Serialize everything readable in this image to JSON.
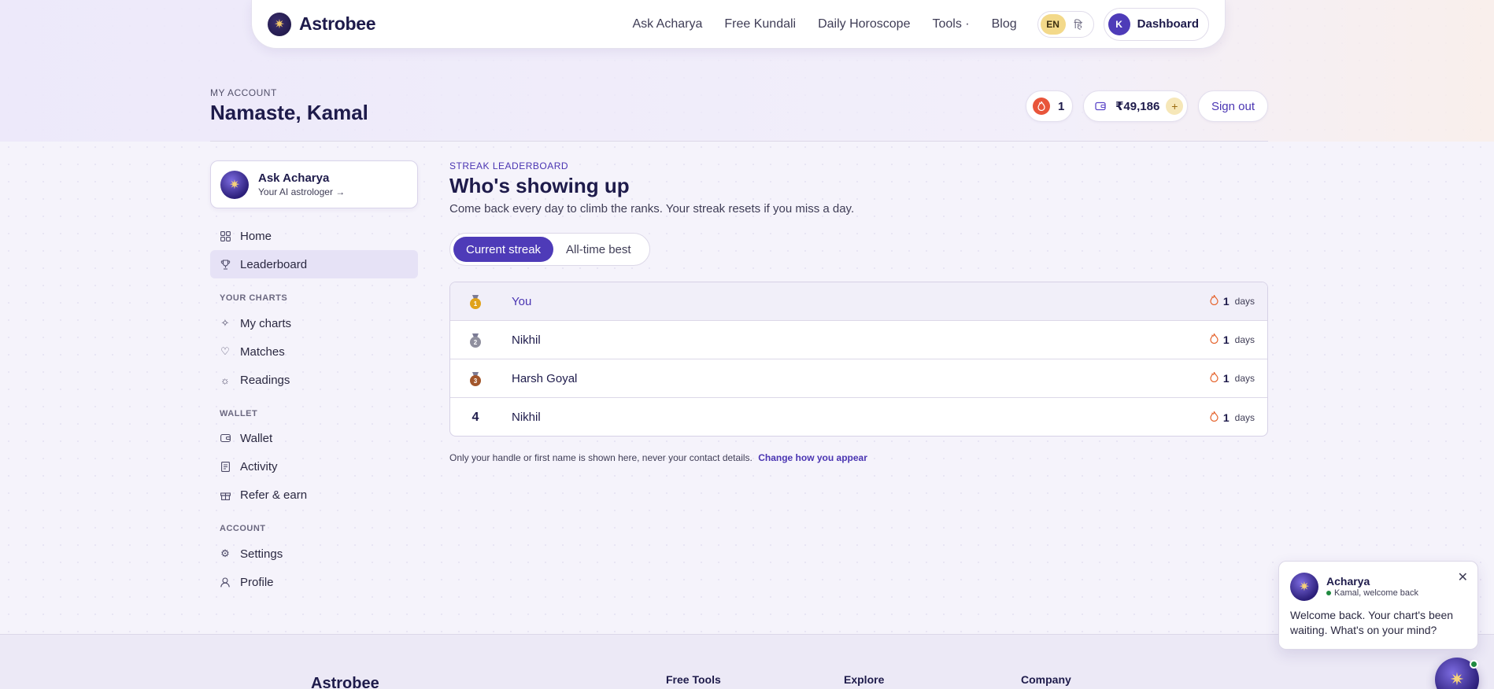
{
  "nav": {
    "brand": "Astrobee",
    "links": [
      "Ask Acharya",
      "Free Kundali",
      "Daily Horoscope",
      "Tools ·",
      "Blog"
    ],
    "lang_en": "EN",
    "lang_hi": "हि",
    "avatar_initial": "K",
    "dashboard_label": "Dashboard"
  },
  "header": {
    "eyebrow": "MY ACCOUNT",
    "title": "Namaste, Kamal",
    "streak_count": "1",
    "wallet_amount": "₹49,186",
    "wallet_add": "+",
    "signout_label": "Sign out"
  },
  "sidebar": {
    "ask_title": "Ask Acharya",
    "ask_sub": "Your AI astrologer →",
    "items": [
      {
        "label": "Home",
        "icon": "grid-icon"
      },
      {
        "label": "Leaderboard",
        "icon": "trophy-icon"
      }
    ],
    "sections": [
      {
        "title": "YOUR CHARTS",
        "items": [
          {
            "label": "My charts",
            "icon": "sparkle-icon"
          },
          {
            "label": "Matches",
            "icon": "heart-icon"
          },
          {
            "label": "Readings",
            "icon": "sun-icon"
          }
        ]
      },
      {
        "title": "WALLET",
        "items": [
          {
            "label": "Wallet",
            "icon": "wallet-icon"
          },
          {
            "label": "Activity",
            "icon": "receipt-icon"
          },
          {
            "label": "Refer & earn",
            "icon": "gift-icon"
          }
        ]
      },
      {
        "title": "ACCOUNT",
        "items": [
          {
            "label": "Settings",
            "icon": "gear-icon"
          },
          {
            "label": "Profile",
            "icon": "user-icon"
          }
        ]
      }
    ]
  },
  "main": {
    "eyebrow": "STREAK LEADERBOARD",
    "title": "Who's showing up",
    "subtitle": "Come back every day to climb the ranks. Your streak resets if you miss a day.",
    "tabs": [
      "Current streak",
      "All-time best"
    ],
    "rows": [
      {
        "rank": "1",
        "name": "You",
        "days": "1",
        "unit": "days"
      },
      {
        "rank": "2",
        "name": "Nikhil",
        "days": "1",
        "unit": "days"
      },
      {
        "rank": "3",
        "name": "Harsh Goyal",
        "days": "1",
        "unit": "days"
      },
      {
        "rank": "4",
        "name": "Nikhil",
        "days": "1",
        "unit": "days"
      }
    ],
    "note": "Only your handle or first name is shown here, never your contact details.",
    "note_link": "Change how you appear"
  },
  "footer": {
    "brand": "Astrobee",
    "columns": [
      "Free Tools",
      "Explore",
      "Company"
    ]
  },
  "chat": {
    "name": "Acharya",
    "status": "Kamal, welcome back",
    "message": "Welcome back. Your chart's been waiting. What's on your mind?",
    "close": "✕"
  },
  "colors": {
    "accent": "#4e3bb8",
    "gold": "#e0a21b",
    "flame": "#e5622b"
  }
}
